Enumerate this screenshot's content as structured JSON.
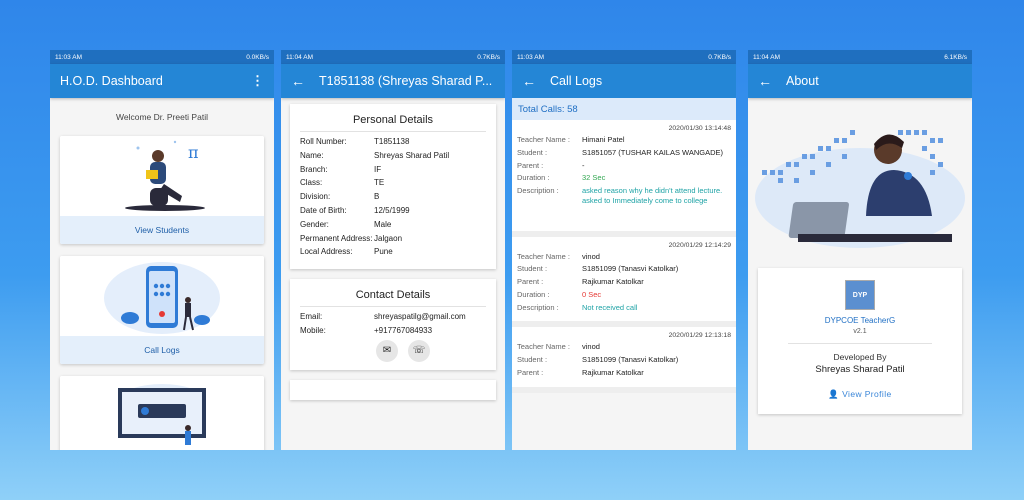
{
  "screens": {
    "dashboard": {
      "status": {
        "time": "11:03 AM",
        "right": "0.0KB/s"
      },
      "title": "H.O.D. Dashboard",
      "menu_icon": "⋮",
      "welcome": "Welcome Dr. Preeti Patil",
      "cards": [
        {
          "label": "View Students",
          "illus": "pi"
        },
        {
          "label": "Call Logs",
          "illus": "π"
        }
      ]
    },
    "student": {
      "status": {
        "time": "11:04 AM",
        "right": "0.7KB/s"
      },
      "title": "T1851138 (Shreyas Sharad P...",
      "personal": {
        "heading": "Personal Details",
        "rows": [
          {
            "k": "Roll Number:",
            "v": "T1851138"
          },
          {
            "k": "Name:",
            "v": "Shreyas Sharad Patil"
          },
          {
            "k": "Branch:",
            "v": "IF"
          },
          {
            "k": "Class:",
            "v": "TE"
          },
          {
            "k": "Division:",
            "v": "B"
          },
          {
            "k": "Date of Birth:",
            "v": "12/5/1999"
          },
          {
            "k": "Gender:",
            "v": "Male"
          },
          {
            "k": "Permanent Address:",
            "v": "Jalgaon"
          },
          {
            "k": "Local Address:",
            "v": "Pune"
          }
        ]
      },
      "contact": {
        "heading": "Contact Details",
        "rows": [
          {
            "k": "Email:",
            "v": "shreyaspatilg@gmail.com"
          },
          {
            "k": "Mobile:",
            "v": "+917767084933"
          }
        ]
      }
    },
    "calllogs": {
      "status": {
        "time": "11:03 AM",
        "right": "0.7KB/s"
      },
      "title": "Call Logs",
      "total": "Total Calls: 58",
      "labels": {
        "teacher": "Teacher Name :",
        "student": "Student :",
        "parent": "Parent :",
        "duration": "Duration :",
        "description": "Description :"
      },
      "logs": [
        {
          "date": "2020/01/30  13:14:48",
          "teacher": "Himani Patel",
          "student": "S1851057 (TUSHAR KAILAS WANGADE)",
          "parent": "-",
          "duration": "32 Sec",
          "description": "asked reason why he didn't attend lecture. asked to  Immediately come to college"
        },
        {
          "date": "2020/01/29  12:14:29",
          "teacher": "vinod",
          "student": "S1851099 (Tanasvi Katolkar)",
          "parent": "Rajkumar Katolkar",
          "duration": "0 Sec",
          "description": "Not received call"
        },
        {
          "date": "2020/01/29  12:13:18",
          "teacher": "vinod",
          "student": "S1851099 (Tanasvi Katolkar)",
          "parent": "Rajkumar Katolkar"
        }
      ]
    },
    "about": {
      "status": {
        "time": "11:04 AM",
        "right": "6.1KB/s"
      },
      "title": "About",
      "app_name": "DYPCOE TeacherG",
      "version": "v2.1",
      "developed_by": "Developed By",
      "developer": "Shreyas Sharad Patil",
      "view_profile": "View Profile"
    }
  },
  "colors": {
    "appbar": "#2486d6",
    "statusbar": "#1f6fbf",
    "accent": "#1f6fc4"
  }
}
